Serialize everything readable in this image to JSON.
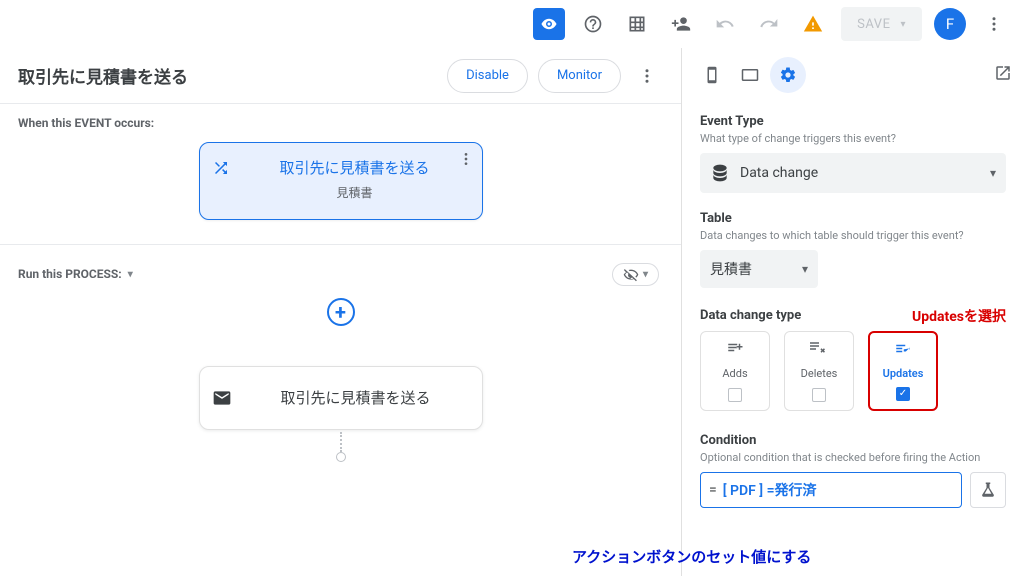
{
  "toolbar": {
    "save_label": "SAVE",
    "avatar_initial": "F"
  },
  "flow": {
    "title": "取引先に見積書を送る",
    "disable_label": "Disable",
    "monitor_label": "Monitor",
    "event_section_label": "When this EVENT occurs:",
    "process_section_label": "Run this PROCESS:",
    "event_node": {
      "title": "取引先に見積書を送る",
      "subtitle": "見積書"
    },
    "process_node": {
      "title": "取引先に見積書を送る"
    }
  },
  "config": {
    "event_type": {
      "label": "Event Type",
      "help": "What type of change triggers this event?",
      "value": "Data change"
    },
    "table": {
      "label": "Table",
      "help": "Data changes to which table should trigger this event?",
      "value": "見積書"
    },
    "data_change_type": {
      "label": "Data change type",
      "options": [
        {
          "label": "Adds",
          "selected": false
        },
        {
          "label": "Deletes",
          "selected": false
        },
        {
          "label": "Updates",
          "selected": true
        }
      ]
    },
    "condition": {
      "label": "Condition",
      "help": "Optional condition that is checked before firing the Action",
      "value": "[ PDF ] =発行済"
    }
  },
  "annotations": {
    "updates_note": "Updatesを選択",
    "condition_note": "アクションボタンのセット値にする"
  }
}
